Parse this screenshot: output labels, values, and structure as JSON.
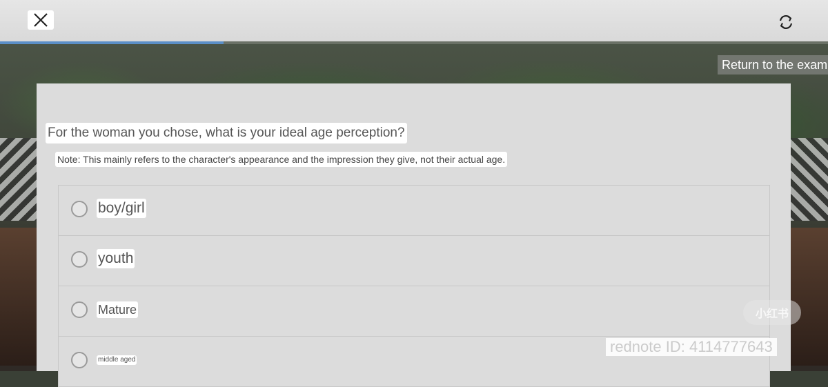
{
  "header": {
    "close_icon": "close-icon",
    "refresh_icon": "refresh-icon",
    "progress_fraction": 0.27
  },
  "return_link": "Return to the exam",
  "question": {
    "title": "For the woman you chose, what is your ideal age perception?",
    "note": "Note: This mainly refers to the character's appearance and the impression they give, not their actual age.",
    "options": [
      {
        "label": "boy/girl"
      },
      {
        "label": "youth"
      },
      {
        "label": "Mature"
      },
      {
        "label": "middle aged"
      }
    ]
  },
  "watermark": {
    "logo_text": "小红书",
    "id_text": "rednote ID: 4114777643"
  }
}
